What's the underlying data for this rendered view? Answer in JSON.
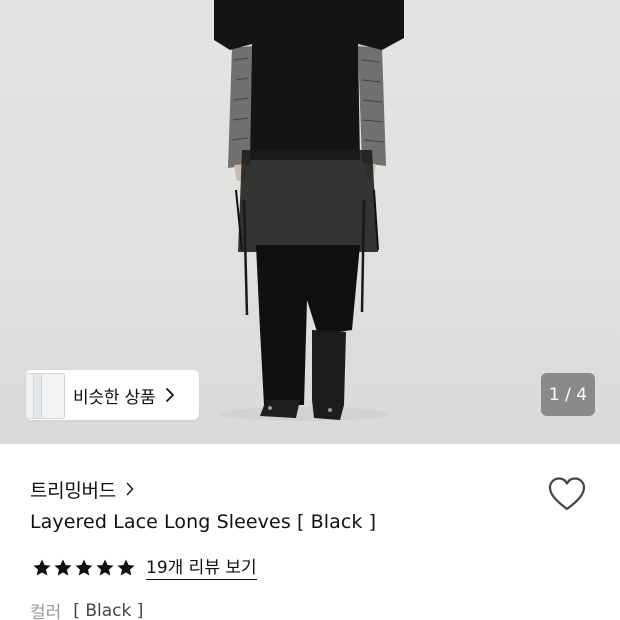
{
  "gallery": {
    "counter": "1 / 4",
    "similar_label": "비슷한 상품"
  },
  "product": {
    "brand": "트리밍버드",
    "title": "Layered Lace Long Sleeves [ Black ]",
    "rating": 5,
    "review_link": "19개 리뷰 보기",
    "option_label": "컬러",
    "option_value": "[ Black ]"
  },
  "colors": {
    "star": "#111111",
    "background": "#e2e2e0",
    "garment": "#141414"
  },
  "icons": {
    "brand_chevron": "chevron-right-icon",
    "similar_chevron": "chevron-right-icon",
    "wishlist": "heart-outline-icon",
    "rating": "star-icon"
  }
}
